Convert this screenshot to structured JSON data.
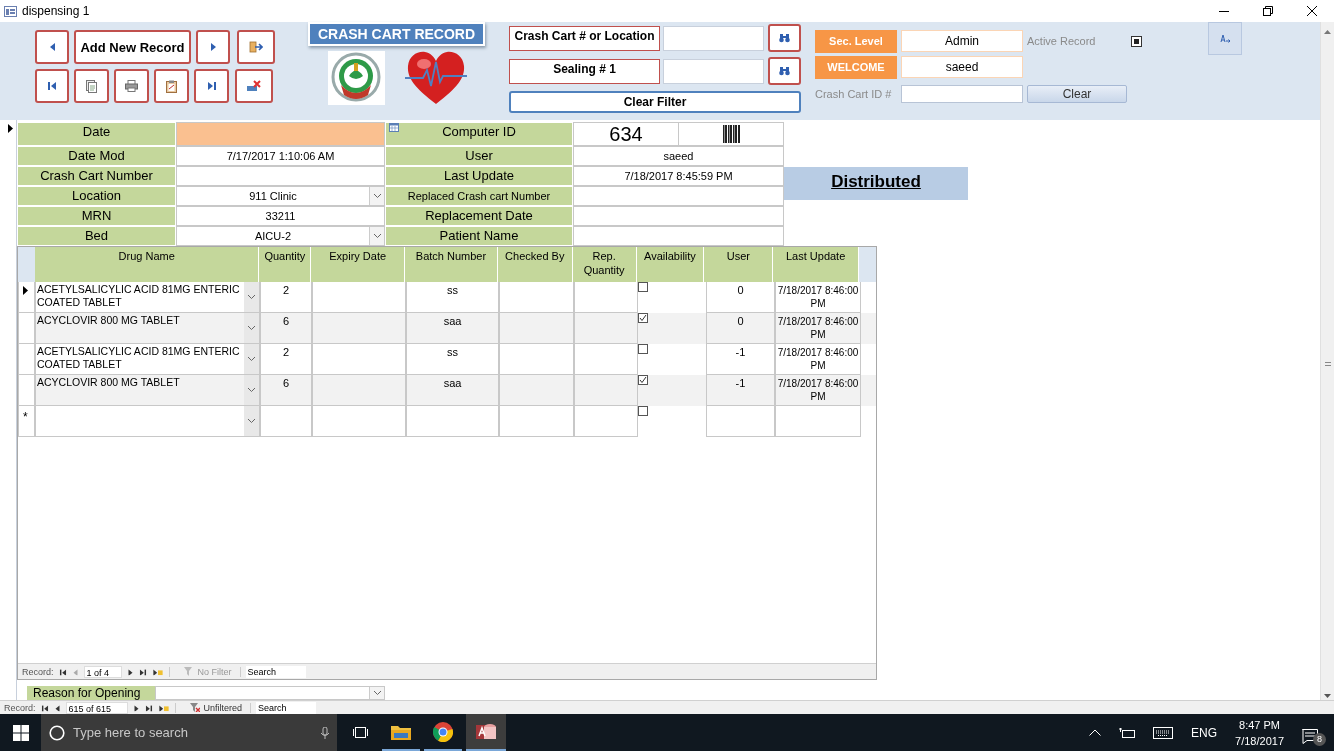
{
  "window": {
    "title": "dispensing 1"
  },
  "header": {
    "title": "CRASH CART RECORD",
    "add_button": "Add New Record",
    "search_fields": [
      {
        "label": "Crash Cart # or Location"
      },
      {
        "label": "Sealing  # 1"
      }
    ],
    "clear_filter": "Clear Filter",
    "sec_level": {
      "label": "Sec. Level",
      "value": "Admin"
    },
    "welcome": {
      "label": "WELCOME",
      "value": "saeed"
    },
    "active_record": {
      "label": "Active Record",
      "checked": true
    },
    "crash_cart_id": {
      "label": "Crash Cart ID #"
    },
    "clear_button": "Clear"
  },
  "form": {
    "left": [
      {
        "label": "Date",
        "kind": "date",
        "focused": true
      },
      {
        "label": "Date Mod",
        "value": "7/17/2017 1:10:06 AM",
        "kind": "text",
        "focused": false
      },
      {
        "label": "Crash Cart Number",
        "kind": "text",
        "focused": false
      },
      {
        "label": "Location",
        "value": "911 Clinic",
        "kind": "combo",
        "focused": false
      },
      {
        "label": "MRN",
        "value": "33211",
        "kind": "text",
        "focused": false
      },
      {
        "label": "Bed",
        "value": "AICU-2",
        "kind": "combo",
        "focused": false
      }
    ],
    "right": [
      {
        "label": "Computer ID",
        "value": "634",
        "kind": "barcode"
      },
      {
        "label": "User",
        "value": "saeed",
        "kind": "text"
      },
      {
        "label": "Last Update",
        "value": "7/18/2017 8:45:59 PM",
        "kind": "text"
      },
      {
        "label": "Replaced Crash cart Number",
        "kind": "text"
      },
      {
        "label": "Replacement Date",
        "kind": "text"
      },
      {
        "label": "Patient Name",
        "kind": "text"
      }
    ],
    "status": "Distributed"
  },
  "grid": {
    "columns": [
      "Drug Name",
      "Quantity",
      "Expiry Date",
      "Batch Number",
      "Checked By",
      "Rep. Quantity",
      "Availability",
      "User",
      "Last Update"
    ],
    "rows": [
      {
        "drug": "ACETYLSALICYLIC ACID 81MG ENTERIC COATED TABLET",
        "quantity": "2",
        "batch": "ss",
        "available": false,
        "user": "0",
        "last_update": "7/18/2017 8:46:00 PM",
        "current": true
      },
      {
        "drug": "ACYCLOVIR 800 MG TABLET",
        "quantity": "6",
        "batch": "saa",
        "available": true,
        "user": "0",
        "last_update": "7/18/2017 8:46:00 PM",
        "current": false
      },
      {
        "drug": "ACETYLSALICYLIC ACID 81MG ENTERIC COATED TABLET",
        "quantity": "2",
        "batch": "ss",
        "available": false,
        "user": "-1",
        "last_update": "7/18/2017 8:46:00 PM",
        "current": false
      },
      {
        "drug": "ACYCLOVIR 800 MG TABLET",
        "quantity": "6",
        "batch": "saa",
        "available": true,
        "user": "-1",
        "last_update": "7/18/2017 8:46:00 PM",
        "current": false
      }
    ],
    "new_row": {
      "marker": "*",
      "available": false
    },
    "nav": {
      "label": "Record:",
      "position": "1 of 4",
      "filter": "No Filter",
      "search": "Search"
    }
  },
  "reason": {
    "label": "Reason for Opening"
  },
  "main_nav": {
    "label": "Record:",
    "position": "615 of 615",
    "filter": "Unfiltered",
    "search": "Search"
  },
  "taskbar": {
    "search_placeholder": "Type here to search",
    "apps": [
      {
        "kind": "files",
        "active": false
      },
      {
        "kind": "browser",
        "active": false
      },
      {
        "kind": "database",
        "active": true
      }
    ],
    "language": "ENG",
    "time": "8:47 PM",
    "date": "7/18/2017",
    "notifications": "8"
  }
}
